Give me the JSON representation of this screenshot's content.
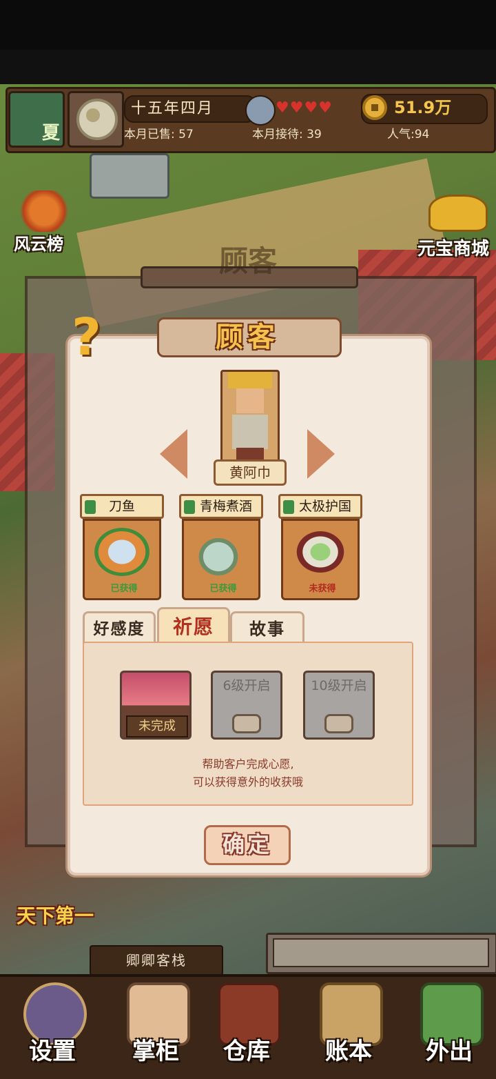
{
  "status_bar": {
    "season": "夏",
    "date": "十五年四月",
    "hearts": "♥♥♥♥",
    "coins": "51.9万",
    "sold_label": "本月已售: 57",
    "served_label": "本月接待: 39",
    "popularity_label": "人气:94"
  },
  "side": {
    "ranking_label": "风云榜",
    "shop_label": "元宝商城"
  },
  "outer_title": "顾客",
  "dialog": {
    "title": "顾客",
    "help": "?",
    "customer_name": "黄阿巾",
    "dishes": [
      {
        "name": "刀鱼",
        "status": "已获得",
        "status_color": "#3d9a3a"
      },
      {
        "name": "青梅煮酒",
        "status": "已获得",
        "status_color": "#3d9a3a"
      },
      {
        "name": "太极护国",
        "status": "未获得",
        "status_color": "#b32a1f"
      }
    ],
    "tabs": [
      "好感度",
      "祈愿",
      "故事"
    ],
    "active_tab": "祈愿",
    "wish_slots": [
      "未完成",
      "6级开启",
      "10级开启"
    ],
    "hint_lines": [
      "帮助客户完成心愿,",
      "可以获得意外的收获哦"
    ],
    "confirm_label": "确定"
  },
  "scene": {
    "champion_banner": "天下第一",
    "inn_name": "卿卿客栈"
  },
  "nav": [
    {
      "label": "设置",
      "icon": "yin-yang-icon"
    },
    {
      "label": "掌柜",
      "icon": "shopkeeper-icon"
    },
    {
      "label": "仓库",
      "icon": "warehouse-chest-icon"
    },
    {
      "label": "账本",
      "icon": "scroll-ledger-icon"
    },
    {
      "label": "外出",
      "icon": "travel-icon"
    }
  ],
  "colors": {
    "accent_gold": "#f6c24f",
    "heart_red": "#d8322d",
    "dialog_bg": "#f3e9dc"
  }
}
